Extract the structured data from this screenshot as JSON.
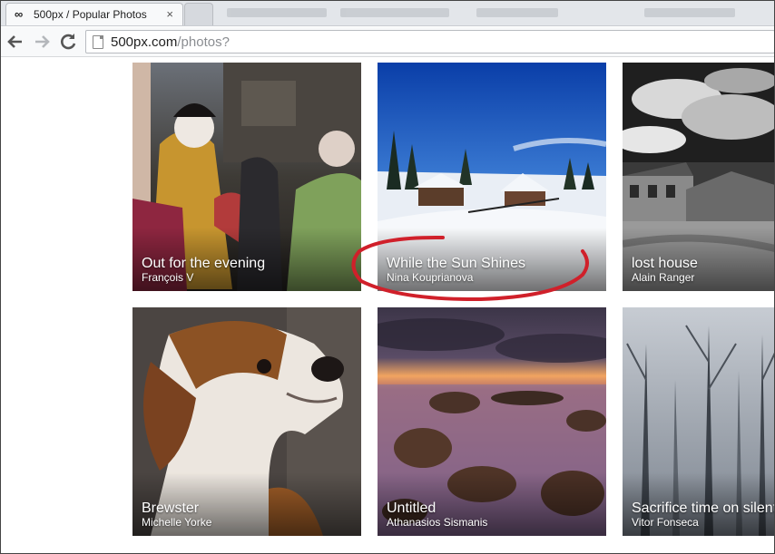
{
  "browser": {
    "tab_title": "500px / Popular Photos",
    "tab_favicon": "∞",
    "close_symbol": "×",
    "url_host": "500px.com",
    "url_path": "/photos?"
  },
  "icons": {
    "back": "arrow-left-icon",
    "forward": "arrow-right-icon",
    "reload": "reload-icon",
    "page": "page-icon",
    "close": "close-icon"
  },
  "photos": [
    {
      "title": "Out for the evening",
      "author": "François V"
    },
    {
      "title": "While the Sun Shines",
      "author": "Nina Kouprianova"
    },
    {
      "title": "lost house",
      "author": "Alain Ranger"
    },
    {
      "title": "Brewster",
      "author": "Michelle Yorke"
    },
    {
      "title": "Untitled",
      "author": "Athanasios Sismanis"
    },
    {
      "title": "Sacrifice time on silent",
      "author": "Vitor Fonseca"
    }
  ],
  "annotation_color": "#d0202a"
}
